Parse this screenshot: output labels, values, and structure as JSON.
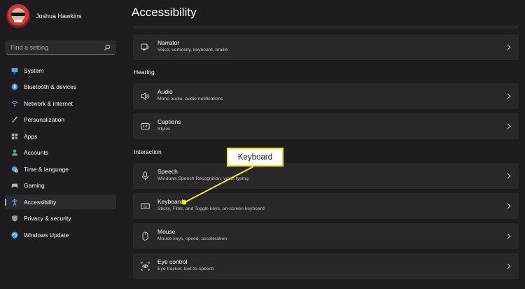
{
  "profile": {
    "name": "Joshua Hawkins"
  },
  "search": {
    "placeholder": "Find a setting"
  },
  "sidebar": {
    "items": [
      {
        "label": "System",
        "icon": "monitor-icon",
        "color": "#4fa3e0"
      },
      {
        "label": "Bluetooth & devices",
        "icon": "bluetooth-icon",
        "color": "#3d8fd6"
      },
      {
        "label": "Network & internet",
        "icon": "wifi-icon",
        "color": "#5aa8e8"
      },
      {
        "label": "Personalization",
        "icon": "brush-icon",
        "color": "#e29a57"
      },
      {
        "label": "Apps",
        "icon": "apps-icon",
        "color": "#b0b0b0"
      },
      {
        "label": "Accounts",
        "icon": "person-icon",
        "color": "#39b58a"
      },
      {
        "label": "Time & language",
        "icon": "globe-clock-icon",
        "color": "#4aa0de"
      },
      {
        "label": "Gaming",
        "icon": "gamepad-icon",
        "color": "#b7b7b7"
      },
      {
        "label": "Accessibility",
        "icon": "accessibility-icon",
        "color": "#5fb4ef",
        "active": true
      },
      {
        "label": "Privacy & security",
        "icon": "shield-icon",
        "color": "#9a9a9a"
      },
      {
        "label": "Windows Update",
        "icon": "update-icon",
        "color": "#3e9ce4"
      }
    ]
  },
  "main": {
    "title": "Accessibility",
    "sections": {
      "hearing": "Hearing",
      "interaction": "Interaction"
    },
    "cards": {
      "narrator": {
        "title": "Narrator",
        "subtitle": "Voice, verbosity, keyboard, braille",
        "icon": "narrator-icon"
      },
      "audio": {
        "title": "Audio",
        "subtitle": "Mono audio, audio notifications",
        "icon": "speaker-icon"
      },
      "captions": {
        "title": "Captions",
        "subtitle": "Styles",
        "icon": "captions-icon"
      },
      "speech": {
        "title": "Speech",
        "subtitle": "Windows Speech Recognition, voice typing",
        "icon": "microphone-icon"
      },
      "keyboard": {
        "title": "Keyboard",
        "subtitle": "Sticky, Filter, and Toggle keys, on-screen keyboard",
        "icon": "keyboard-icon"
      },
      "mouse": {
        "title": "Mouse",
        "subtitle": "Mouse keys, speed, acceleration",
        "icon": "mouse-icon"
      },
      "eye_control": {
        "title": "Eye control",
        "subtitle": "Eye tracker, text-to-speech",
        "icon": "eye-icon"
      }
    }
  },
  "annotation": {
    "label": "Keyboard",
    "color": "#f2e41c"
  }
}
